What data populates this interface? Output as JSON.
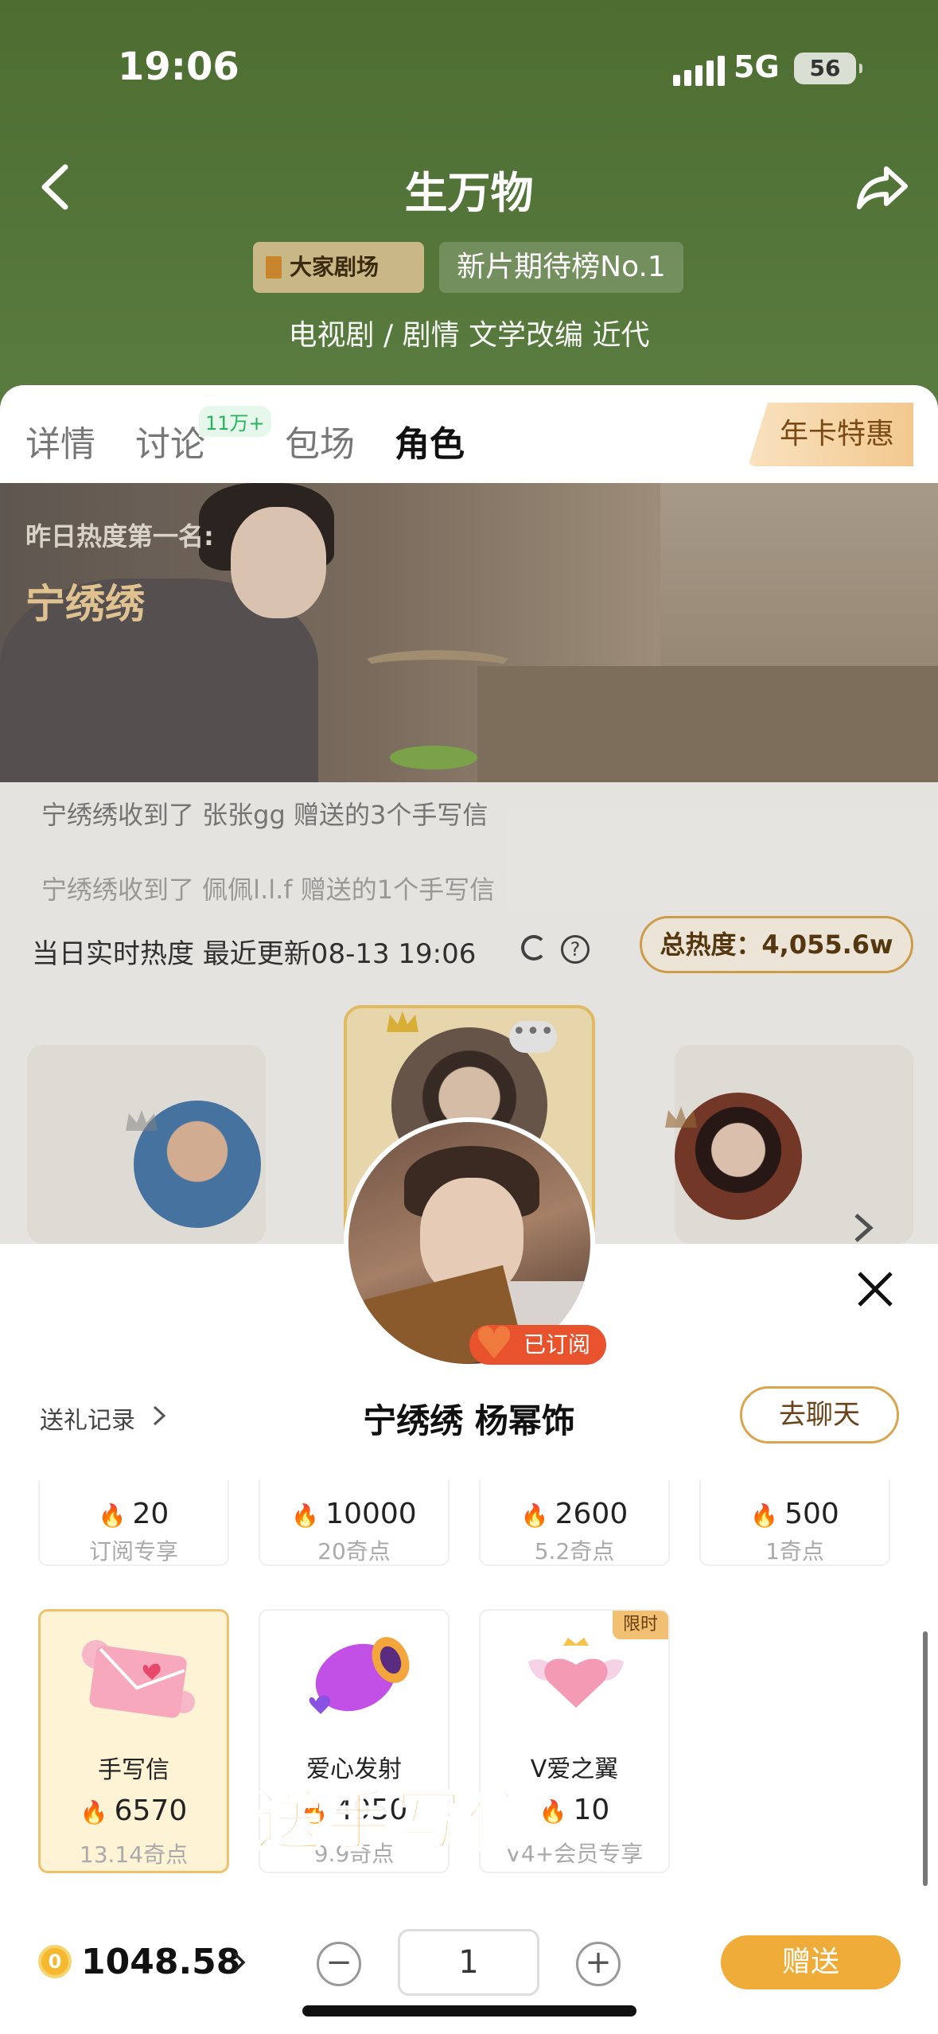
{
  "status": {
    "time": "19:06",
    "network": "5G",
    "battery": "56"
  },
  "header": {
    "title": "生万物",
    "brand_tag": "大家剧场",
    "rank_tag": "新片期待榜No.1",
    "genres": "电视剧 / 剧情 文学改编 近代"
  },
  "tabs": [
    {
      "label": "详情"
    },
    {
      "label": "讨论",
      "badge": "11万+"
    },
    {
      "label": "包场"
    },
    {
      "label": "角色"
    }
  ],
  "annual_card": "年卡特惠",
  "hero": {
    "label": "昨日热度第一名:",
    "name": "宁绣绣"
  },
  "marquee": [
    "宁绣绣收到了 张张gg 赠送的3个手写信",
    "宁绣绣收到了 佩佩l.l.f 赠送的1个手写信"
  ],
  "heat": {
    "realtime": "当日实时热度 最近更新08-13 19:06",
    "total": "总热度：4,055.6w"
  },
  "sheet": {
    "gift_record": "送礼记录",
    "role_name": "宁绣绣 杨幂饰",
    "chat_button": "去聊天",
    "subscribed": "已订阅"
  },
  "gifts_top": [
    {
      "cost": "20",
      "sub": "订阅专享"
    },
    {
      "cost": "10000",
      "sub": "20奇点"
    },
    {
      "cost": "2600",
      "sub": "5.2奇点"
    },
    {
      "cost": "500",
      "sub": "1奇点"
    }
  ],
  "gifts": [
    {
      "name": "手写信",
      "cost": "6570",
      "sub": "13.14奇点",
      "icon": "envelope-icon"
    },
    {
      "name": "爱心发射",
      "cost": "4950",
      "sub": "9.9奇点",
      "icon": "heart-cannon-icon"
    },
    {
      "name": "V爱之翼",
      "cost": "10",
      "sub": "V4+会员专享",
      "badge": "限时",
      "icon": "winged-heart-icon"
    }
  ],
  "overlay_text": "送手写信",
  "bottom": {
    "balance": "1048.58",
    "quantity": "1",
    "send_button": "赠送",
    "coin": "0"
  },
  "colors": {
    "header_green": "#55763a",
    "accent_gold": "#f0ac38",
    "fire": "#ef6c2a"
  }
}
